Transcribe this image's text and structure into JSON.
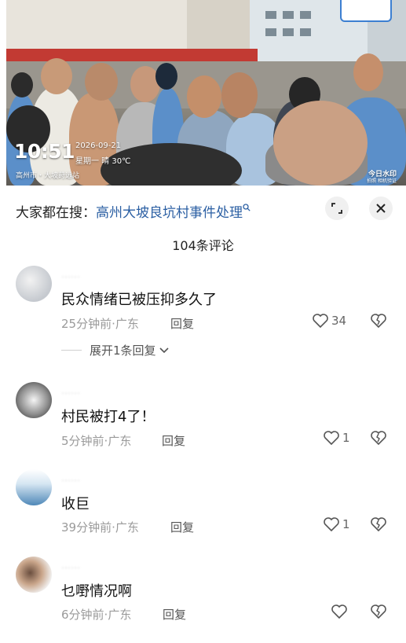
{
  "video": {
    "time": "10:51",
    "date": "2026-09-21",
    "weather": "星期一 晴 30℃",
    "location": "高州市・大坡莳远站",
    "watermark_title": "今日水印",
    "watermark_sub": "拍照 相机验证"
  },
  "search": {
    "prefix": "大家都在搜：",
    "query": "高州大坡良坑村事件处理"
  },
  "comment_count": "104条评论",
  "comments": [
    {
      "username": "……",
      "text": "民众情绪已被压抑多久了",
      "time": "25分钟前",
      "region": "广东",
      "reply_label": "回复",
      "likes": "34",
      "expand": "展开1条回复"
    },
    {
      "username": "……",
      "text": "村民被打4了！",
      "time": "5分钟前",
      "region": "广东",
      "reply_label": "回复",
      "likes": "1"
    },
    {
      "username": "……",
      "text": "收巨",
      "time": "39分钟前",
      "region": "广东",
      "reply_label": "回复",
      "likes": "1"
    },
    {
      "username": "……",
      "text": "乜嘢情况啊",
      "time": "6分钟前",
      "region": "广东",
      "reply_label": "回复",
      "likes": ""
    }
  ],
  "colors": {
    "search_highlight": "#2b5fa3",
    "meta_gray": "#9a9a9a",
    "police_blue": "#5b8fc9"
  },
  "icons": [
    "search-icon",
    "expand-icon",
    "close-icon",
    "heart-icon",
    "broken-heart-icon",
    "chevron-down-icon"
  ]
}
